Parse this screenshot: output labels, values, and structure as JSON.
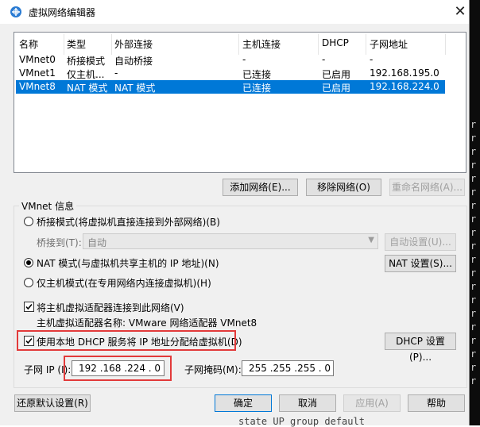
{
  "window": {
    "title": "虚拟网络编辑器",
    "close_glyph": "✕"
  },
  "table": {
    "headers": [
      "名称",
      "类型",
      "外部连接",
      "主机连接",
      "DHCP",
      "子网地址"
    ],
    "rows": [
      [
        "VMnet0",
        "桥接模式",
        "自动桥接",
        "-",
        "-",
        "-"
      ],
      [
        "VMnet1",
        "仅主机...",
        "-",
        "已连接",
        "已启用",
        "192.168.195.0"
      ],
      [
        "VMnet8",
        "NAT 模式",
        "NAT 模式",
        "已连接",
        "已启用",
        "192.168.224.0"
      ]
    ],
    "selected_row": 2
  },
  "buttons": {
    "add": "添加网络(E)...",
    "remove": "移除网络(O)",
    "rename": "重命名网络(A)...",
    "auto_settings": "自动设置(U)...",
    "nat_settings": "NAT 设置(S)...",
    "dhcp_settings": "DHCP 设置(P)...",
    "restore": "还原默认设置(R)",
    "ok": "确定",
    "cancel": "取消",
    "apply": "应用(A)",
    "help": "帮助"
  },
  "vmnet_info": {
    "group_title": "VMnet 信息",
    "bridged": "桥接模式(将虚拟机直接连接到外部网络)(B)",
    "bridged_to_label": "桥接到(T):",
    "bridged_to_value": "自动",
    "nat": "NAT 模式(与虚拟机共享主机的 IP 地址)(N)",
    "host_only": "仅主机模式(在专用网络内连接虚拟机)(H)",
    "selected_mode": "nat",
    "connect_adapter": "将主机虚拟适配器连接到此网络(V)",
    "connect_adapter_checked": true,
    "adapter_name": "主机虚拟适配器名称: VMware 网络适配器 VMnet8",
    "use_dhcp": "使用本地 DHCP 服务将 IP 地址分配给虚拟机(D)",
    "use_dhcp_checked": true
  },
  "subnet": {
    "ip_label": "子网 IP (I):",
    "ip_value": "192 .168 .224 . 0",
    "mask_label": "子网掩码(M):",
    "mask_value": "255 .255 .255 . 0"
  },
  "terminal": {
    "prompts": [
      "r",
      "r",
      "r",
      "r",
      "r",
      "r",
      "r",
      "r",
      "r",
      "r",
      "r",
      "r",
      "r",
      "r",
      "r",
      "r",
      "r",
      "r",
      "r",
      "r"
    ],
    "last_line": "state UP group default"
  },
  "colors": {
    "selection": "#0078d7",
    "highlight_box": "#e23a3a",
    "default_button_border": "#0078d7"
  }
}
